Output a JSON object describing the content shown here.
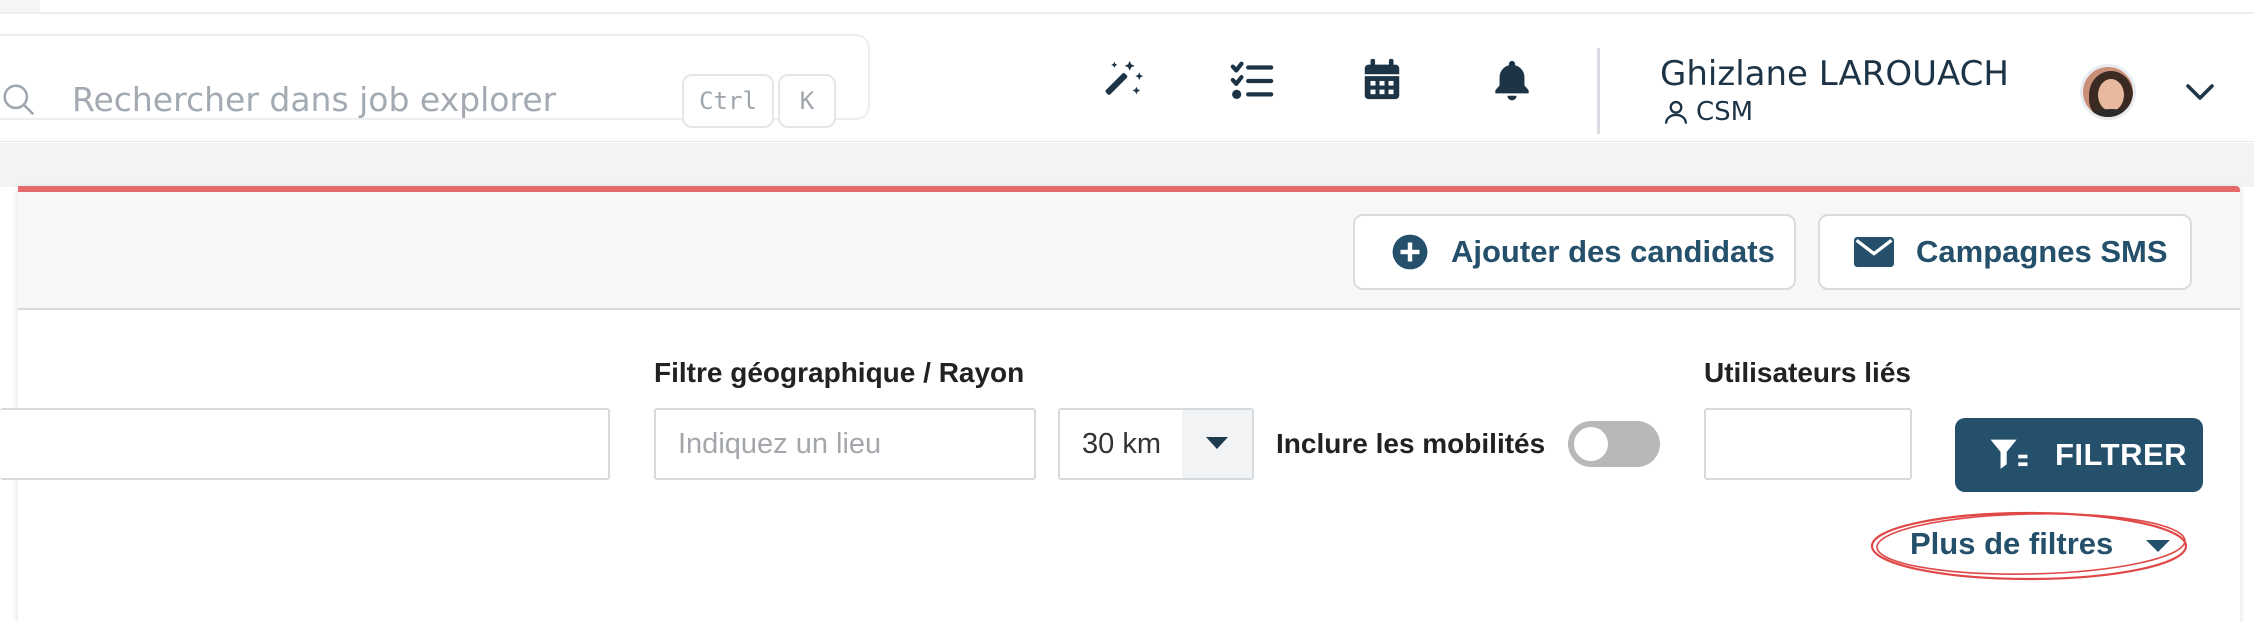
{
  "header": {
    "search": {
      "placeholder": "Rechercher dans job explorer",
      "shortcut_keys": [
        "Ctrl",
        "K"
      ]
    },
    "icons": [
      "magic-wand-icon",
      "checklist-icon",
      "calendar-icon",
      "bell-icon"
    ],
    "user": {
      "name": "Ghizlane LAROUACH",
      "role": "CSM"
    }
  },
  "toolbar": {
    "add_candidates_label": "Ajouter des candidats",
    "sms_campaigns_label": "Campagnes SMS"
  },
  "filters": {
    "geo_label": "Filtre géographique / Rayon",
    "place_placeholder": "Indiquez un lieu",
    "radius_value": "30 km",
    "mobility_label": "Inclure les mobilités",
    "mobility_enabled": false,
    "linked_users_label": "Utilisateurs liés",
    "filter_button_label": "FILTRER",
    "more_filters_label": "Plus de filtres"
  },
  "colors": {
    "brand": "#24506b",
    "accent_bar": "#e56b6b",
    "annotation": "#e04848"
  }
}
